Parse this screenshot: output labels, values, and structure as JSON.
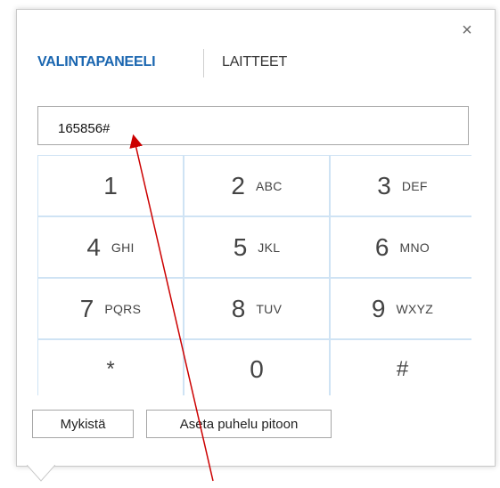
{
  "dialog": {
    "close_symbol": "×",
    "tabs": [
      {
        "label": "VALINTAPANEELI",
        "active": true
      },
      {
        "label": "LAITTEET",
        "active": false
      }
    ],
    "dial_value": "165856#",
    "keys": [
      {
        "digit": "1",
        "letters": ""
      },
      {
        "digit": "2",
        "letters": "ABC"
      },
      {
        "digit": "3",
        "letters": "DEF"
      },
      {
        "digit": "4",
        "letters": "GHI"
      },
      {
        "digit": "5",
        "letters": "JKL"
      },
      {
        "digit": "6",
        "letters": "MNO"
      },
      {
        "digit": "7",
        "letters": "PQRS"
      },
      {
        "digit": "8",
        "letters": "TUV"
      },
      {
        "digit": "9",
        "letters": "WXYZ"
      },
      {
        "digit": "*",
        "letters": ""
      },
      {
        "digit": "0",
        "letters": ""
      },
      {
        "digit": "#",
        "letters": ""
      }
    ],
    "buttons": {
      "mute_label": "Mykistä",
      "hold_label": "Aseta puhelu pitoon"
    }
  },
  "colors": {
    "accent": "#1a66b0",
    "grid_line": "#cfe3f4",
    "annotation_arrow": "#cc0000"
  }
}
